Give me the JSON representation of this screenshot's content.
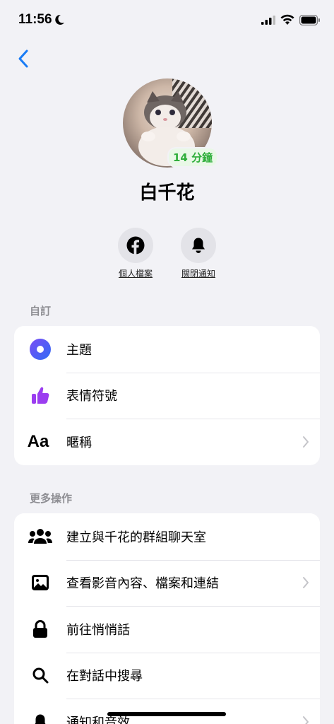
{
  "status_bar": {
    "time": "11:56"
  },
  "profile": {
    "name": "白千花",
    "active_badge": "14 分鐘"
  },
  "quick_actions": [
    {
      "label": "個人檔案",
      "icon": "facebook-icon"
    },
    {
      "label": "關閉通知",
      "icon": "bell-icon"
    }
  ],
  "sections": {
    "customize": {
      "title": "自訂",
      "items": [
        {
          "label": "主題",
          "icon": "theme-icon"
        },
        {
          "label": "表情符號",
          "icon": "thumbs-up-icon"
        },
        {
          "label": "暱稱",
          "icon": "aa-icon",
          "icon_text": "Aa"
        }
      ]
    },
    "more_actions": {
      "title": "更多操作",
      "items": [
        {
          "label": "建立與千花的群組聊天室",
          "icon": "people-icon"
        },
        {
          "label": "查看影音內容、檔案和連結",
          "icon": "image-icon"
        },
        {
          "label": "前往悄悄話",
          "icon": "lock-icon"
        },
        {
          "label": "在對話中搜尋",
          "icon": "search-icon"
        },
        {
          "label": "通知和音效",
          "icon": "bell-icon"
        }
      ]
    }
  },
  "colors": {
    "accent_blue": "#1a7cf5",
    "active_green": "#2fae3b",
    "theme_gradient": [
      "#7a4cf5",
      "#2f6cf5"
    ],
    "emoji_purple": "#9b3df0"
  }
}
